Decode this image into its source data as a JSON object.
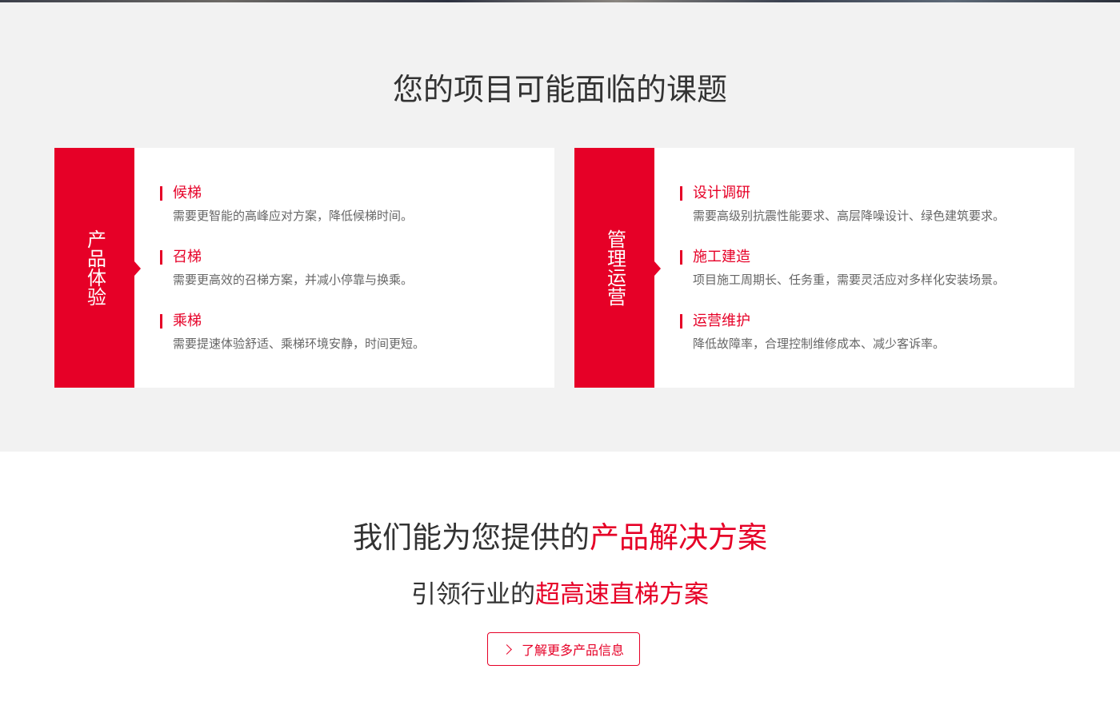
{
  "challenges": {
    "title": "您的项目可能面临的课题",
    "cards": [
      {
        "tab": "产品体验",
        "items": [
          {
            "title": "候梯",
            "desc": "需要更智能的高峰应对方案，降低候梯时间。"
          },
          {
            "title": "召梯",
            "desc": "需要更高效的召梯方案，并减小停靠与换乘。"
          },
          {
            "title": "乘梯",
            "desc": "需要提速体验舒适、乘梯环境安静，时间更短。"
          }
        ]
      },
      {
        "tab": "管理运营",
        "items": [
          {
            "title": "设计调研",
            "desc": "需要高级别抗震性能要求、高层降噪设计、绿色建筑要求。"
          },
          {
            "title": "施工建造",
            "desc": "项目施工周期长、任务重，需要灵活应对多样化安装场景。"
          },
          {
            "title": "运营维护",
            "desc": "降低故障率，合理控制维修成本、减少客诉率。"
          }
        ]
      }
    ]
  },
  "solutions": {
    "title_plain": "我们能为您提供的",
    "title_accent": "产品解决方案",
    "subtitle_plain": "引领行业的",
    "subtitle_accent": "超高速直梯方案",
    "button_label": "了解更多产品信息"
  },
  "colors": {
    "accent": "#e60027",
    "section_bg": "#f2f2f2",
    "text": "#333333",
    "muted_text": "#666666"
  },
  "icons": {
    "button_icon": "chevron-right-icon"
  }
}
